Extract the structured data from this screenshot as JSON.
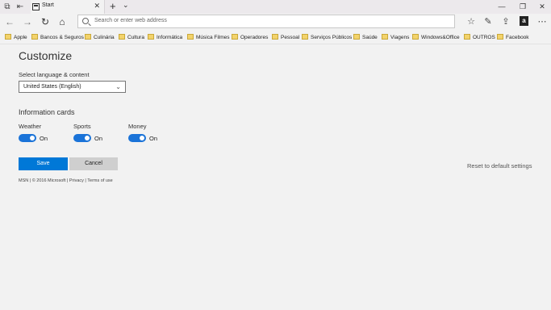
{
  "tab": {
    "title": "Start"
  },
  "address": {
    "placeholder": "Search or enter web address"
  },
  "favorites": [
    {
      "label": "Apple"
    },
    {
      "label": "Bancos & Seguros"
    },
    {
      "label": "Culinária"
    },
    {
      "label": "Cultura"
    },
    {
      "label": "Informática"
    },
    {
      "label": "Música Filmes"
    },
    {
      "label": "Operadores"
    },
    {
      "label": "Pessoal"
    },
    {
      "label": "Serviços Públicos"
    },
    {
      "label": "Saúde"
    },
    {
      "label": "Viagens"
    },
    {
      "label": "Windows&Office"
    },
    {
      "label": "OUTROS"
    },
    {
      "label": "Facebook"
    }
  ],
  "page": {
    "title": "Customize",
    "language_label": "Select language & content",
    "language_value": "United States (English)",
    "cards_title": "Information cards",
    "cards": [
      {
        "label": "Weather",
        "state": "On"
      },
      {
        "label": "Sports",
        "state": "On"
      },
      {
        "label": "Money",
        "state": "On"
      }
    ],
    "save_label": "Save",
    "cancel_label": "Cancel",
    "reset_label": "Reset to default settings",
    "footer": "MSN | © 2016 Microsoft | Privacy | Terms of use"
  },
  "colors": {
    "accent": "#0078d7",
    "toggle": "#1a73d8",
    "background": "#f2f2f2"
  }
}
